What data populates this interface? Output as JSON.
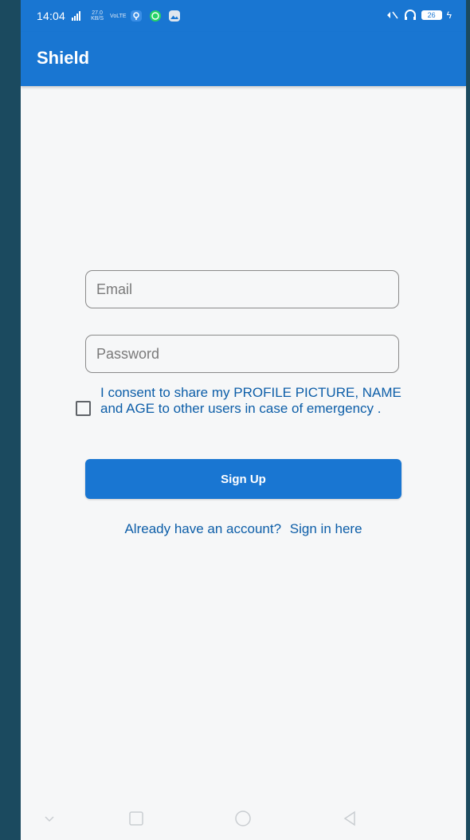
{
  "status_bar": {
    "time": "14:04",
    "network_speed": "27.0 KB/S",
    "volte": "VoLTE",
    "battery": "26"
  },
  "app_bar": {
    "title": "Shield"
  },
  "form": {
    "email_placeholder": "Email",
    "password_placeholder": "Password",
    "consent_text": "I consent to share my PROFILE PICTURE, NAME and AGE to other users in case of emergency .",
    "signup_label": "Sign Up",
    "signin_prompt": "Already have an account?",
    "signin_link": "Sign in here"
  },
  "colors": {
    "primary": "#1976d2",
    "link": "#0d5ea8",
    "background": "#f6f7f8",
    "outer": "#1b4a5f"
  },
  "icons": {
    "nav": [
      "chevron-down-icon",
      "recent-apps-icon",
      "home-icon",
      "back-icon"
    ],
    "status": [
      "signal-icon",
      "location-icon",
      "whatsapp-icon",
      "gallery-icon",
      "mute-icon",
      "headphones-icon",
      "battery-icon",
      "charging-icon"
    ]
  }
}
